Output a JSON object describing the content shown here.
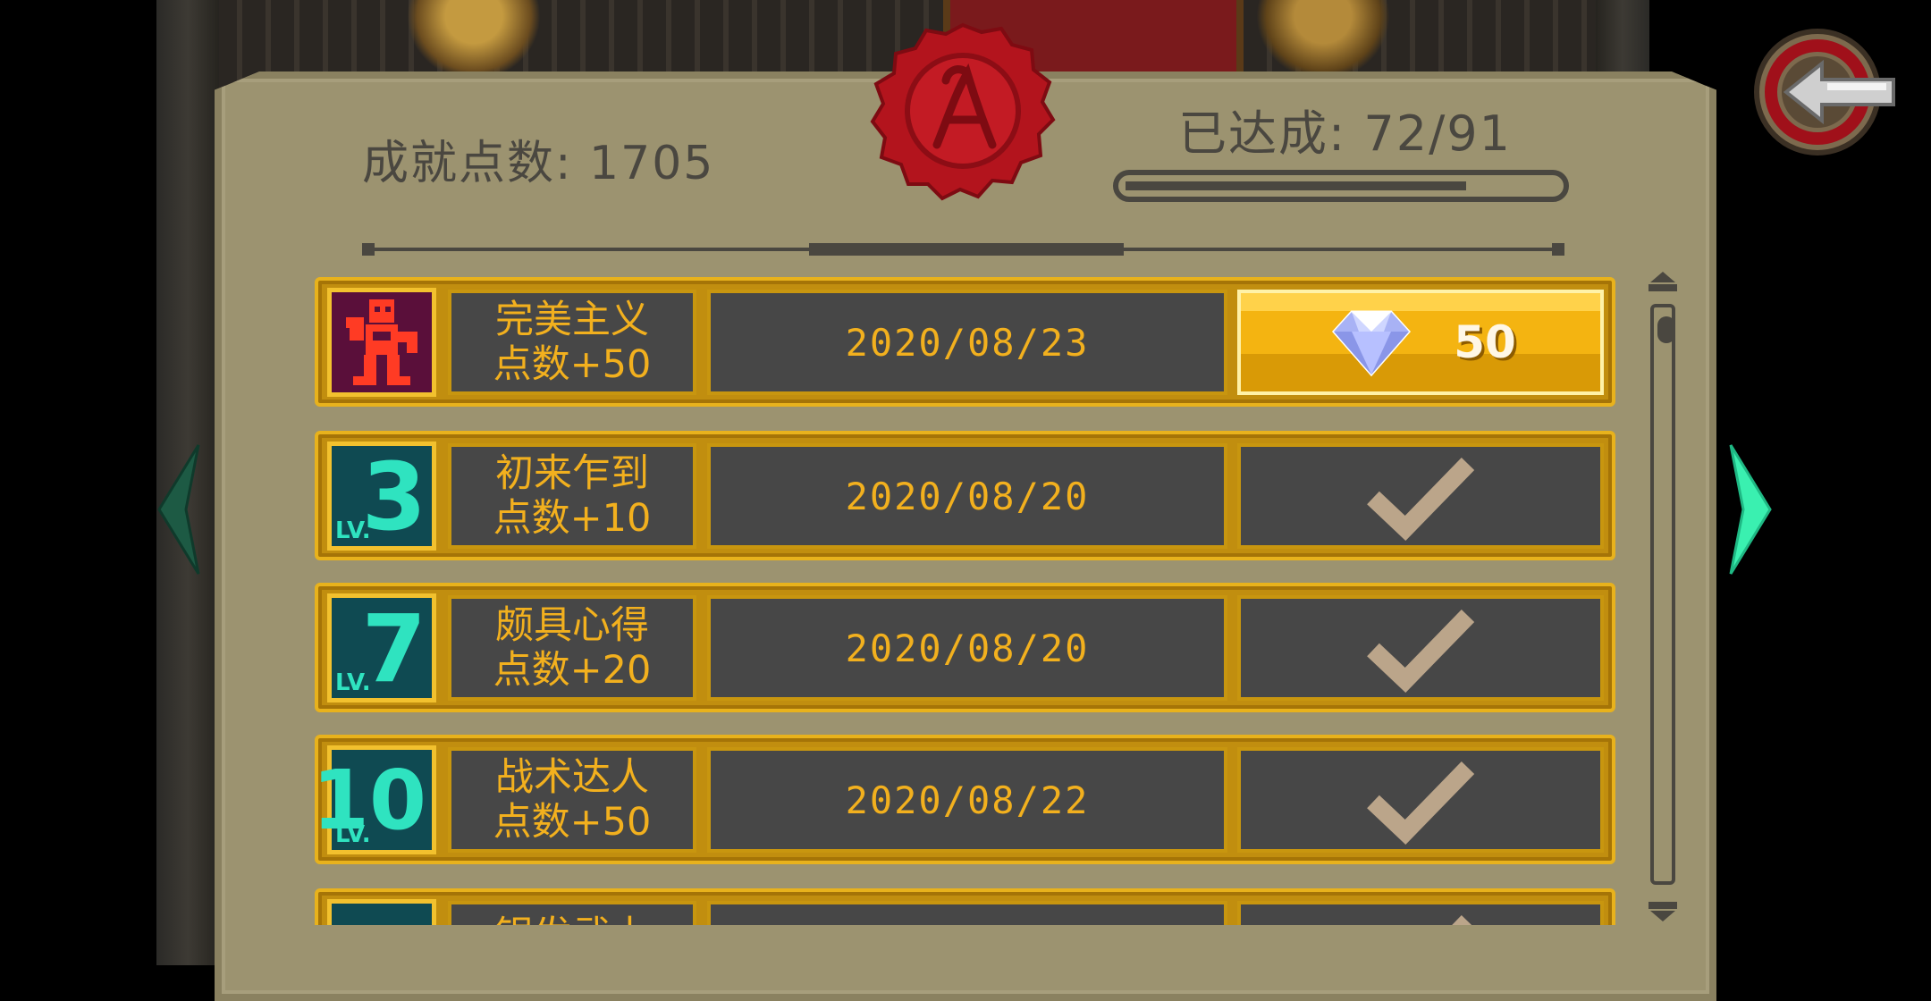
{
  "header": {
    "points_label": "成就点数: 1705",
    "achieved_label": "已达成: 72/91",
    "progress_fraction": 0.79
  },
  "achievements": [
    {
      "title": "完美主义",
      "points": "点数+50",
      "date": "2020/08/23",
      "icon": "perfect-icon",
      "status": "claimable",
      "reward": "50",
      "reward_icon": "diamond-icon"
    },
    {
      "title": "初来乍到",
      "points": "点数+10",
      "date": "2020/08/20",
      "icon": "level-badge",
      "level": "3",
      "level_prefix": "LV.",
      "status": "claimed"
    },
    {
      "title": "颇具心得",
      "points": "点数+20",
      "date": "2020/08/20",
      "icon": "level-badge",
      "level": "7",
      "level_prefix": "LV.",
      "status": "claimed"
    },
    {
      "title": "战术达人",
      "points": "点数+50",
      "date": "2020/08/22",
      "icon": "level-badge",
      "level": "10",
      "level_prefix": "LV.",
      "status": "claimed"
    },
    {
      "title": "银发武士",
      "points": "",
      "date": "",
      "icon": "level-badge",
      "level": "",
      "level_prefix": "",
      "status": "claimed"
    }
  ],
  "colors": {
    "panel": "#9c9370",
    "row_gold": "#c18e0f",
    "cell_dark": "#474747",
    "text_gold": "#f2b01e",
    "level_teal": "#2fe3c0",
    "seal_red": "#b3141d"
  }
}
